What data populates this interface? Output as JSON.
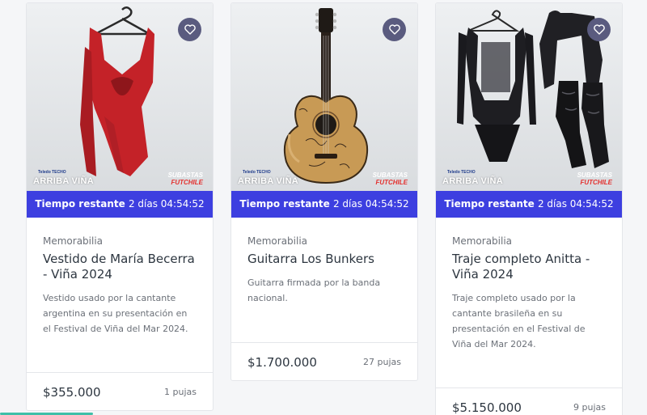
{
  "timer_label": "Tiempo restante",
  "cards": [
    {
      "badge_left": "ARRIBA VIÑA",
      "badge_right_top": "SUBASTAS",
      "badge_right_bottom": "FUTCHILE",
      "sponsor_text": "Teledo TECHO",
      "timer_value": "2 días 04:54:52",
      "category": "Memorabilia",
      "title": "Vestido de María Becerra - Viña 2024",
      "description": "Vestido usado por la cantante argentina en su presentación en el Festival de Viña del Mar 2024.",
      "price": "$355.000",
      "bids": "1 pujas"
    },
    {
      "badge_left": "ARRIBA VIÑA",
      "badge_right_top": "SUBASTAS",
      "badge_right_bottom": "FUTCHILE",
      "sponsor_text": "Teledo TECHO",
      "timer_value": "2 días 04:54:52",
      "category": "Memorabilia",
      "title": "Guitarra Los Bunkers",
      "description": "Guitarra firmada por la banda nacional.",
      "price": "$1.700.000",
      "bids": "27 pujas"
    },
    {
      "badge_left": "ARRIBA VIÑA",
      "badge_right_top": "SUBASTAS",
      "badge_right_bottom": "FUTCHILE",
      "sponsor_text": "Teledo TECHO",
      "timer_value": "2 días 04:54:52",
      "category": "Memorabilia",
      "title": "Traje completo Anitta - Viña 2024",
      "description": "Traje completo usado por la cantante brasileña en su presentación en el Festival de Viña del Mar 2024.",
      "price": "$5.150.000",
      "bids": "9 pujas"
    }
  ],
  "colors": {
    "timer_bg": "#3d3fe0",
    "fav_bg": "#5a5b7f",
    "dress": "#c42228",
    "guitar": "#c89a55",
    "outfit": "#1e1e22"
  }
}
